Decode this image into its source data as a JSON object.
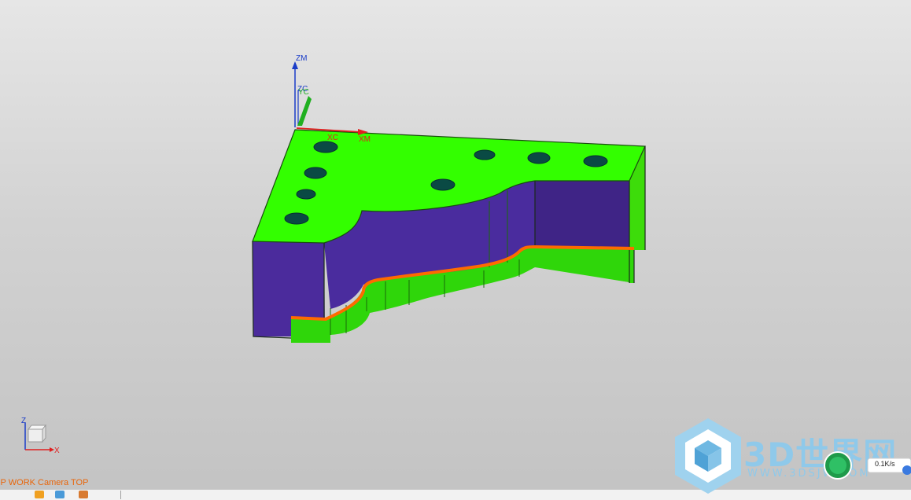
{
  "viewport": {
    "background_top": "#e6e6e6",
    "background_bottom": "#c3c3c3"
  },
  "model": {
    "top_face_color": "#33ff00",
    "wall_color": "#4a2a9a",
    "toolpath_color": "#ff6a00",
    "hole_color": "#0a4a44"
  },
  "wcs": {
    "zm_label": "ZM",
    "zc_label": "ZC",
    "yc_label": "YC",
    "xc_label": "XC",
    "xm_label": "XM",
    "z_color": "#1a3cc8",
    "x_color": "#e02020",
    "y_color": "#20b020"
  },
  "triad": {
    "z_label": "Z",
    "x_label": "X"
  },
  "status": {
    "text": "OP WORK Camera TOP",
    "color": "#e8650a"
  },
  "watermark": {
    "brand": "3D世界网",
    "url": "WWW.3DSJW.COM",
    "color": "#8fc9ea"
  },
  "network": {
    "speed": "0.1K/s",
    "badge_color": "#1f9a4a"
  }
}
